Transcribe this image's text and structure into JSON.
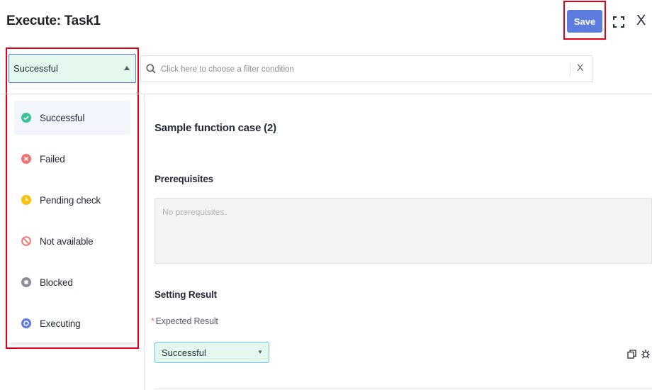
{
  "header": {
    "title": "Execute: Task1",
    "save_label": "Save",
    "close_label": "X"
  },
  "status_filter": {
    "selected": "Successful",
    "options": [
      {
        "label": "Successful",
        "icon": "check-circle-icon",
        "color": "#3ac295"
      },
      {
        "label": "Failed",
        "icon": "x-circle-icon",
        "color": "#f66f6a"
      },
      {
        "label": "Pending check",
        "icon": "clock-circle-icon",
        "color": "#fac20a"
      },
      {
        "label": "Not available",
        "icon": "ban-icon",
        "color": "#f66f6a"
      },
      {
        "label": "Blocked",
        "icon": "blocked-circle-icon",
        "color": "#8a8e99"
      },
      {
        "label": "Executing",
        "icon": "executing-circle-icon",
        "color": "#5e7ce0"
      }
    ]
  },
  "filter": {
    "placeholder": "Click here to choose a filter condition",
    "clear_label": "X"
  },
  "case": {
    "title": "Sample function case (2)",
    "prerequisites_label": "Prerequisites",
    "prerequisites_placeholder": "No prerequisites.",
    "setting_result_label": "Setting Result",
    "expected_result_label": "Expected Result",
    "expected_result_required": "*",
    "expected_result_value": "Successful"
  },
  "colors": {
    "accent": "#5e7ce0",
    "success_bg": "#e4f8ed",
    "highlight": "#e0001b"
  }
}
